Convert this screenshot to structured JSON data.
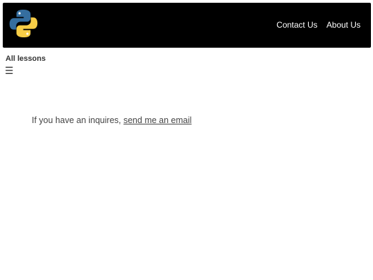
{
  "header": {
    "logo_icon": "python-logo-icon",
    "logo_colors": {
      "blue": "#356e9f",
      "yellow": "#f7cd46"
    },
    "nav": [
      {
        "label": "Contact Us"
      },
      {
        "label": "About Us"
      }
    ]
  },
  "sidebar": {
    "title": "All lessons",
    "menu_icon": "☰"
  },
  "main": {
    "inquiry_text": "If you have an inquires,",
    "email_link": "send me an email"
  }
}
